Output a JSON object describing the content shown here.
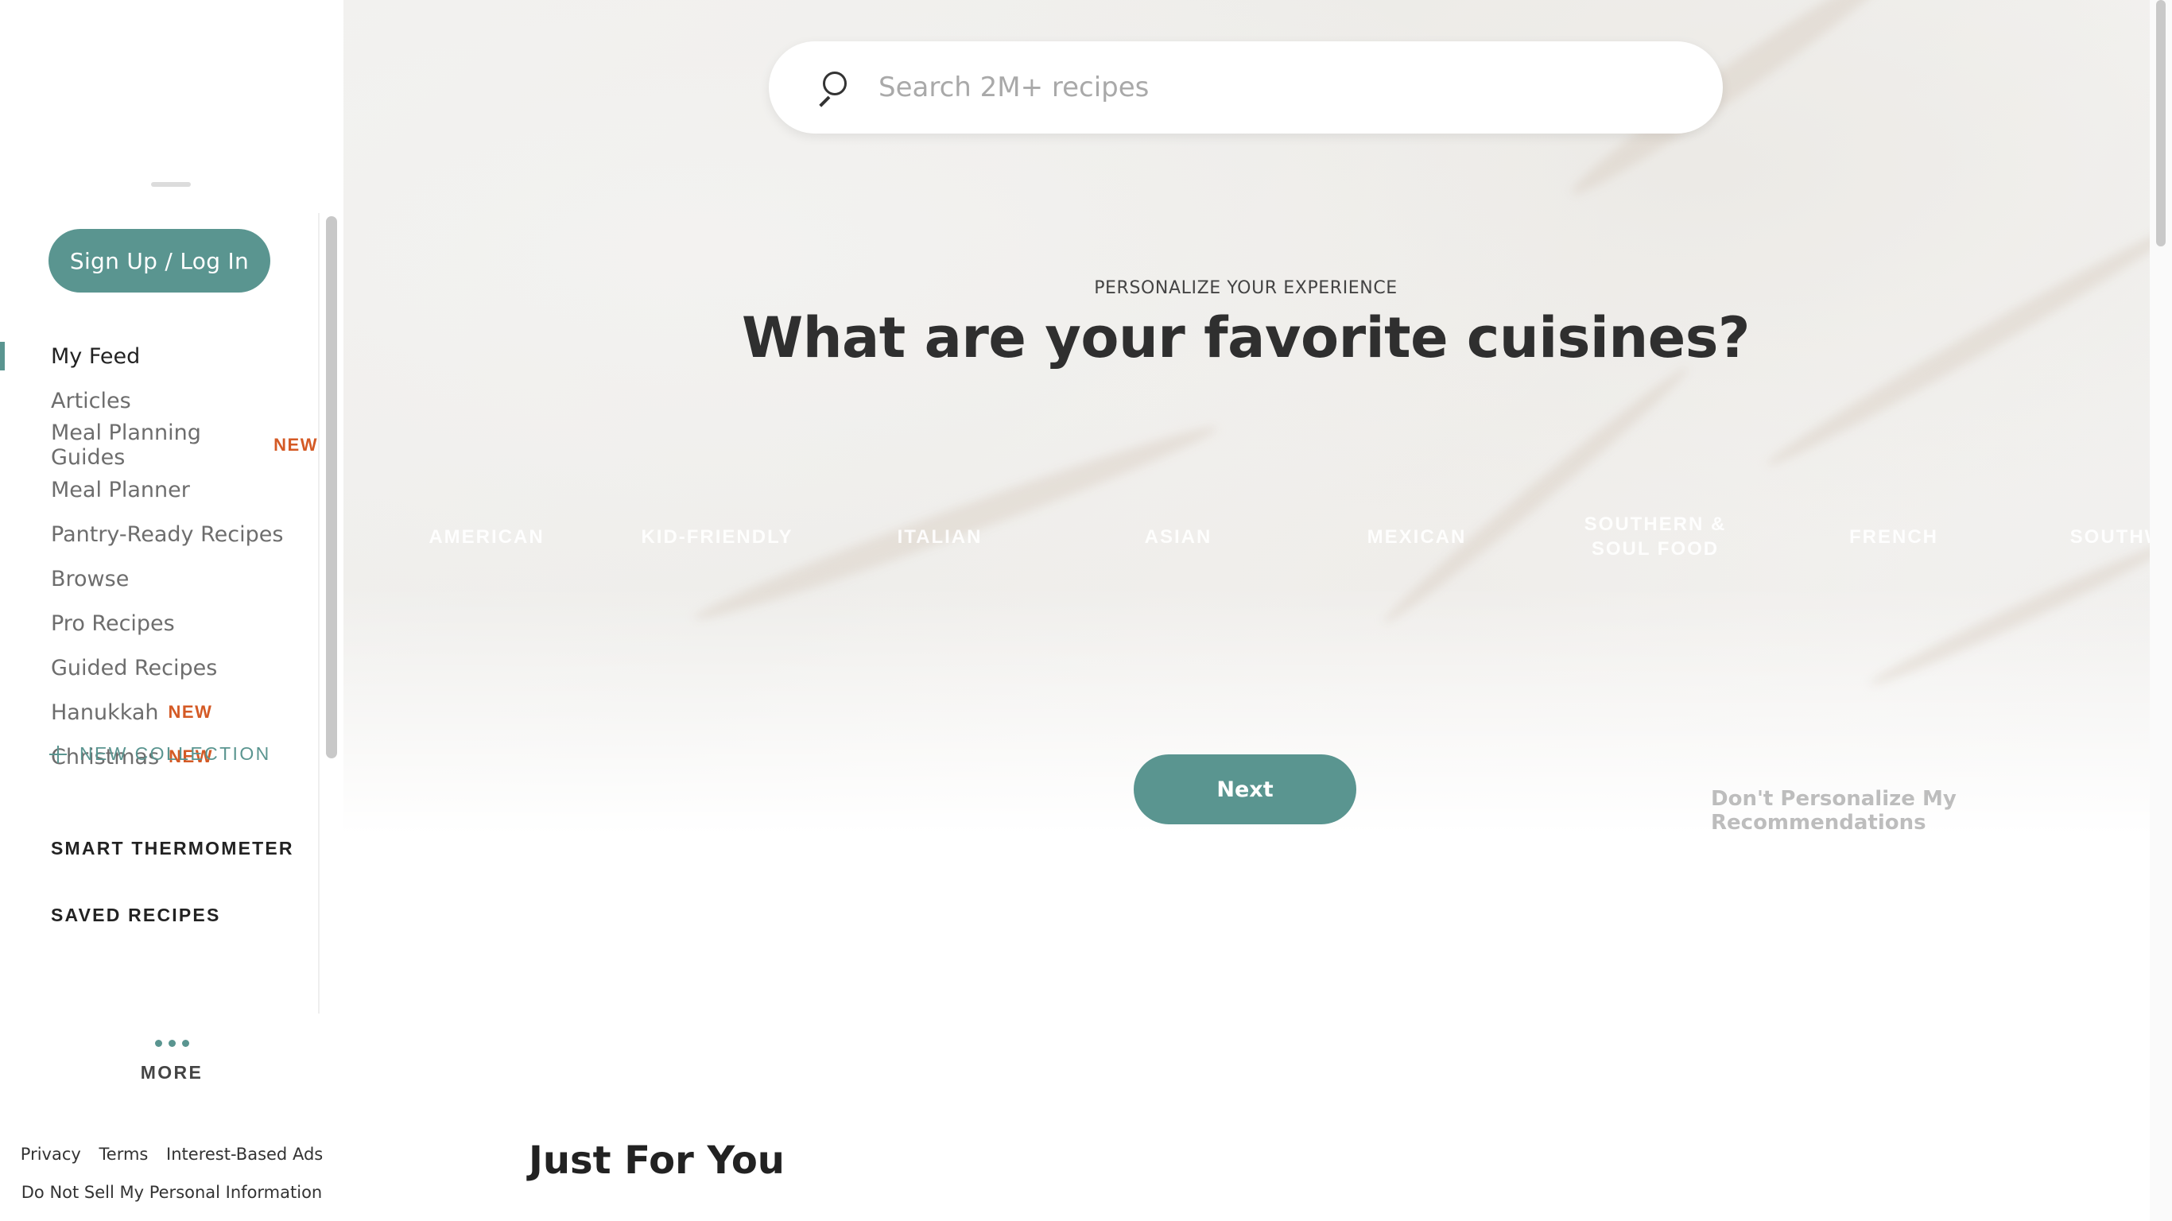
{
  "sidebar": {
    "signup_label": "Sign Up / Log In",
    "items": [
      {
        "label": "My Feed",
        "badge": "",
        "active": true
      },
      {
        "label": "Articles",
        "badge": ""
      },
      {
        "label": "Meal Planning Guides",
        "badge": "NEW"
      },
      {
        "label": "Meal Planner",
        "badge": ""
      },
      {
        "label": "Pantry-Ready Recipes",
        "badge": ""
      },
      {
        "label": "Browse",
        "badge": ""
      },
      {
        "label": "Pro Recipes",
        "badge": ""
      },
      {
        "label": "Guided Recipes",
        "badge": ""
      },
      {
        "label": "Hanukkah",
        "badge": "NEW"
      },
      {
        "label": "Christmas",
        "badge": "NEW"
      }
    ],
    "smart_thermometer": "SMART THERMOMETER",
    "saved_recipes": "SAVED RECIPES",
    "new_collection": "NEW COLLECTION",
    "more": "MORE",
    "footer": {
      "privacy": "Privacy",
      "terms": "Terms",
      "interest_ads": "Interest-Based Ads",
      "do_not_sell": "Do Not Sell My Personal Information"
    }
  },
  "search": {
    "placeholder": "Search 2M+ recipes",
    "icon": "search-icon"
  },
  "personalize": {
    "kicker": "PERSONALIZE YOUR EXPERIENCE",
    "headline": "What are your favorite cuisines?",
    "cuisines": [
      "AMERICAN",
      "KID-FRIENDLY",
      "ITALIAN",
      "ASIAN",
      "MEXICAN",
      "SOUTHERN & SOUL FOOD",
      "FRENCH",
      "SOUTHWE"
    ],
    "next_label": "Next",
    "skip_label": "Don't Personalize My Recommendations"
  },
  "feed": {
    "section_title": "Just For You"
  },
  "colors": {
    "accent": "#5a9590",
    "new_badge": "#d45a25"
  }
}
